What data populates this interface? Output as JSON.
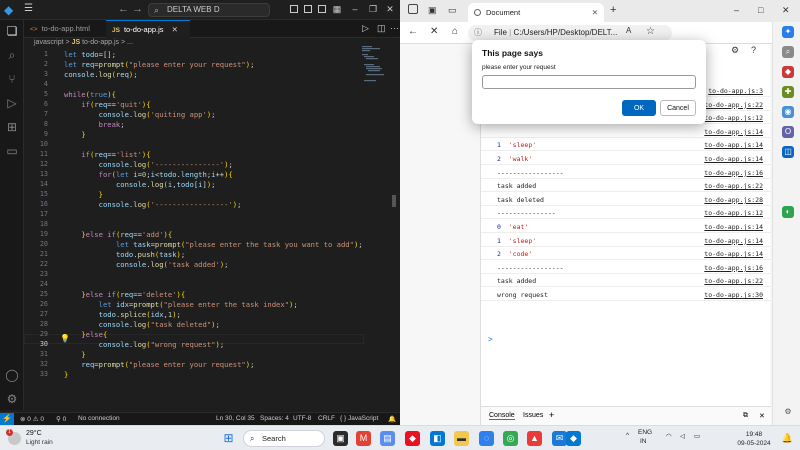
{
  "vscode": {
    "search_text": "DELTA WEB D",
    "tabs": [
      {
        "label": "to-do-app.html",
        "badge": "<>"
      },
      {
        "label": "to-do-app.js",
        "badge": "JS"
      }
    ],
    "breadcrumb": {
      "folder": "javascript",
      "sep": ">",
      "js": "JS",
      "file": "to-do-app.js",
      "tail": "> ..."
    },
    "current_line": 30,
    "code_lines": [
      "let todo=[];",
      "let req=prompt(\"please enter your request\");",
      "console.log(req);",
      "",
      "while(true){",
      "    if(req=='quit'){",
      "        console.log('quiting app');",
      "        break;",
      "    }",
      "",
      "    if(req=='list'){",
      "        console.log('---------------');",
      "        for(let i=0;i<todo.length;i++){",
      "            console.log(i,todo[i]);",
      "        }",
      "        console.log('-----------------');",
      "",
      "",
      "    }else if(req=='add'){",
      "            let task=prompt(\"please enter the task you want to add\");",
      "            todo.push(task);",
      "            console.log('task added');",
      "",
      "",
      "    }else if(req=='delete'){",
      "        let idx=prompt(\"please enter the task index\");",
      "        todo.splice(idx,1);",
      "        console.log(\"task deleted\");",
      "    }else{",
      "        console.log(\"wrong request\");",
      "    }",
      "    req=prompt(\"please enter your request\");",
      "}"
    ],
    "status": {
      "errors": "0",
      "warnings": "0",
      "ports": "0",
      "connection": "No connection",
      "position": "Ln 30, Col 35",
      "spaces": "Spaces: 4",
      "encoding": "UTF-8",
      "eol": "CRLF",
      "language": "{ } JavaScript"
    }
  },
  "browser": {
    "tab_title": "Document",
    "url_prefix": "File",
    "url": "C:/Users/HP/Desktop/DELT...",
    "console_rows": [
      {
        "num": "",
        "text": "",
        "src": "to-do-app.js:3"
      },
      {
        "num": "",
        "text": "",
        "src": "to-do-app.js:22"
      },
      {
        "num": "",
        "text": "",
        "src": "to-do-app.js:12"
      },
      {
        "num": "",
        "text": "",
        "src": "to-do-app.js:14"
      },
      {
        "num": "1",
        "text": "'sleep'",
        "src": "to-do-app.js:14"
      },
      {
        "num": "2",
        "text": "'walk'",
        "src": "to-do-app.js:14"
      },
      {
        "num": "",
        "text": "-----------------",
        "src": "to-do-app.js:16"
      },
      {
        "num": "",
        "text": "task added",
        "src": "to-do-app.js:22"
      },
      {
        "num": "",
        "text": "task deleted",
        "src": "to-do-app.js:28"
      },
      {
        "num": "",
        "text": "---------------",
        "src": "to-do-app.js:12"
      },
      {
        "num": "0",
        "text": "'eat'",
        "src": "to-do-app.js:14"
      },
      {
        "num": "1",
        "text": "'sleep'",
        "src": "to-do-app.js:14"
      },
      {
        "num": "2",
        "text": "'code'",
        "src": "to-do-app.js:14"
      },
      {
        "num": "",
        "text": "-----------------",
        "src": "to-do-app.js:16"
      },
      {
        "num": "",
        "text": "task added",
        "src": "to-do-app.js:22"
      },
      {
        "num": "",
        "text": "wrong request",
        "src": "to-do-app.js:30"
      }
    ],
    "prompt_caret": ">",
    "devtools_tabs": [
      "Console",
      "Issues"
    ]
  },
  "dialog": {
    "title": "This page says",
    "message": "please enter your request",
    "input_value": "",
    "ok_label": "OK",
    "cancel_label": "Cancel"
  },
  "taskbar": {
    "weather_temp": "29°C",
    "weather_cond": "Light rain",
    "weather_badge": "1",
    "search_label": "Search",
    "lang_top": "ENG",
    "lang_bottom": "IN",
    "time": "19:48",
    "date": "09-05-2024"
  },
  "colors": {
    "accent": "#0078d4",
    "dialog_ok": "#0067c0",
    "vscode_bg": "#1e1e1e"
  }
}
